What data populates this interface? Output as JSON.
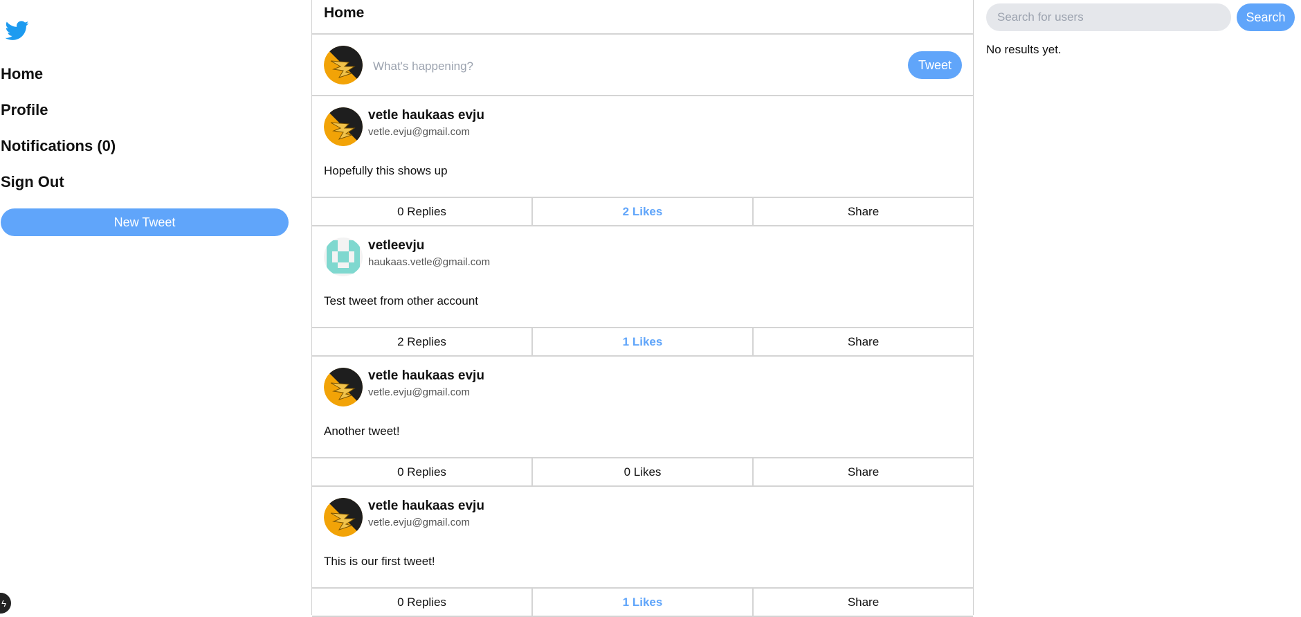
{
  "sidebar": {
    "logo_icon": "bird-icon",
    "nav": [
      {
        "label": "Home"
      },
      {
        "label": "Profile"
      },
      {
        "label": "Notifications (0)"
      },
      {
        "label": "Sign Out"
      }
    ],
    "new_tweet_label": "New Tweet"
  },
  "main": {
    "title": "Home",
    "composer": {
      "placeholder": "What's happening?",
      "button_label": "Tweet"
    },
    "tweets": [
      {
        "name": "vetle haukaas evju",
        "email": "vetle.evju@gmail.com",
        "text": "Hopefully this shows up",
        "avatar": "wing-avatar",
        "replies": "0 Replies",
        "likes": "2 Likes",
        "liked": true,
        "share": "Share"
      },
      {
        "name": "vetleevju",
        "email": "haukaas.vetle@gmail.com",
        "text": "Test tweet from other account",
        "avatar": "identicon-avatar",
        "replies": "2 Replies",
        "likes": "1 Likes",
        "liked": true,
        "share": "Share"
      },
      {
        "name": "vetle haukaas evju",
        "email": "vetle.evju@gmail.com",
        "text": "Another tweet!",
        "avatar": "wing-avatar",
        "replies": "0 Replies",
        "likes": "0 Likes",
        "liked": false,
        "share": "Share"
      },
      {
        "name": "vetle haukaas evju",
        "email": "vetle.evju@gmail.com",
        "text": "This is our first tweet!",
        "avatar": "wing-avatar",
        "replies": "0 Replies",
        "likes": "1 Likes",
        "liked": true,
        "share": "Share"
      }
    ]
  },
  "right": {
    "search_placeholder": "Search for users",
    "search_button": "Search",
    "no_results": "No results yet."
  },
  "colors": {
    "accent": "#60a5fa",
    "twitter_blue": "#1d9bf0",
    "border": "#d4d4d4"
  }
}
